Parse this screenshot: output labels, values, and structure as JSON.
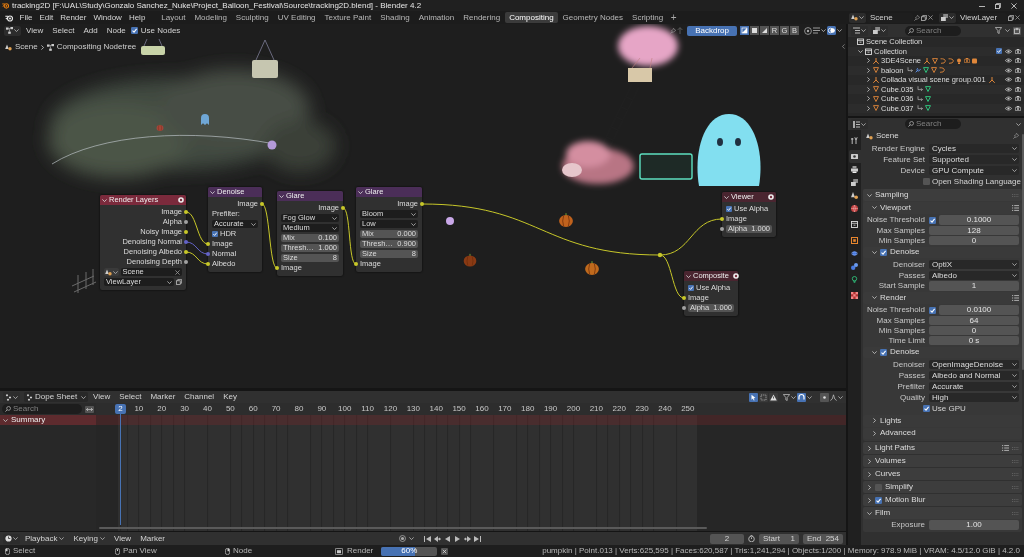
{
  "title_bar": {
    "title": "tracking2D [F:\\UAL\\Study\\Gonzalo Sanchez_Nuke\\Project_Balloon_Festival\\Source\\tracking2D.blend] - Blender 4.2"
  },
  "top_bar": {
    "menus": [
      "File",
      "Edit",
      "Render",
      "Window",
      "Help"
    ],
    "workspaces": [
      {
        "label": "Layout",
        "selected": false
      },
      {
        "label": "Modeling",
        "selected": false
      },
      {
        "label": "Sculpting",
        "selected": false
      },
      {
        "label": "UV Editing",
        "selected": false
      },
      {
        "label": "Texture Paint",
        "selected": false
      },
      {
        "label": "Shading",
        "selected": false
      },
      {
        "label": "Animation",
        "selected": false
      },
      {
        "label": "Rendering",
        "selected": false
      },
      {
        "label": "Compositing",
        "selected": true
      },
      {
        "label": "Geometry Nodes",
        "selected": false
      },
      {
        "label": "Scripting",
        "selected": false
      }
    ],
    "add_workspace": "+",
    "scene": "Scene",
    "view_layer": "ViewLayer"
  },
  "node_editor": {
    "menus": [
      "View",
      "Select",
      "Add",
      "Node"
    ],
    "use_nodes": {
      "label": "Use Nodes",
      "checked": true
    },
    "backdrop": {
      "label": "Backdrop",
      "on": true
    },
    "channels": [
      {
        "kind": "color_alpha",
        "selected": true
      },
      {
        "kind": "color",
        "selected": false
      },
      {
        "kind": "alpha",
        "selected": false
      },
      {
        "kind": "letter",
        "label": "R",
        "selected": false
      },
      {
        "kind": "letter",
        "label": "G",
        "selected": false
      },
      {
        "kind": "letter",
        "label": "B",
        "selected": false
      }
    ],
    "overlays": {
      "on": true
    },
    "breadcrumbs": [
      "Scene",
      "Compositing Nodetree"
    ],
    "nodes": [
      {
        "title": "Render Layers",
        "kind": "input",
        "color": "#7b2a3c",
        "rows": [
          {
            "kind": "output",
            "label": "Image",
            "color": "#c7c729"
          },
          {
            "kind": "output",
            "label": "Alpha",
            "color": "#a1a1a1"
          },
          {
            "kind": "output",
            "label": "Noisy Image",
            "color": "#c7c729"
          },
          {
            "kind": "output",
            "label": "Denoising Normal",
            "color": "#6363c7"
          },
          {
            "kind": "output",
            "label": "Denoising Albedo",
            "color": "#c7c729"
          },
          {
            "kind": "output",
            "label": "Denoising Depth",
            "color": "#a1a1a1"
          },
          {
            "kind": "scene",
            "value": "Scene"
          },
          {
            "kind": "layer",
            "value": "ViewLayer"
          }
        ]
      },
      {
        "title": "Denoise",
        "kind": "filter",
        "color": "#4b2e58",
        "rows": [
          {
            "kind": "output",
            "label": "Image",
            "color": "#c7c729"
          },
          {
            "kind": "label",
            "label": "Prefilter:"
          },
          {
            "kind": "dropdown",
            "value": "Accurate"
          },
          {
            "kind": "checkbox",
            "label": "HDR",
            "checked": true
          },
          {
            "kind": "input",
            "label": "Image",
            "color": "#c7c729"
          },
          {
            "kind": "input",
            "label": "Normal",
            "color": "#6363c7"
          },
          {
            "kind": "input",
            "label": "Albedo",
            "color": "#c7c729"
          }
        ]
      },
      {
        "title": "Glare",
        "kind": "filter",
        "color": "#4b2e58",
        "rows": [
          {
            "kind": "output",
            "label": "Image",
            "color": "#c7c729"
          },
          {
            "kind": "dropdown",
            "value": "Fog Glow"
          },
          {
            "kind": "dropdown",
            "value": "Medium"
          },
          {
            "kind": "field",
            "label": "Mix",
            "value": "0.100"
          },
          {
            "kind": "field",
            "label": "Thresh…",
            "value": "1.000"
          },
          {
            "kind": "field",
            "label": "Size",
            "value": "8"
          },
          {
            "kind": "input",
            "label": "Image",
            "color": "#c7c729"
          }
        ]
      },
      {
        "title": "Glare",
        "kind": "filter",
        "color": "#4b2e58",
        "rows": [
          {
            "kind": "output",
            "label": "Image",
            "color": "#c7c729"
          },
          {
            "kind": "dropdown",
            "value": "Bloom"
          },
          {
            "kind": "dropdown",
            "value": "Low"
          },
          {
            "kind": "field",
            "label": "Mix",
            "value": "0.000"
          },
          {
            "kind": "field",
            "label": "Thresh…",
            "value": "0.900"
          },
          {
            "kind": "field",
            "label": "Size",
            "value": "8"
          },
          {
            "kind": "input",
            "label": "Image",
            "color": "#c7c729"
          }
        ]
      },
      {
        "title": "Viewer",
        "kind": "output",
        "color": "#4a2530",
        "rows": [
          {
            "kind": "checkbox",
            "label": "Use Alpha",
            "checked": true
          },
          {
            "kind": "input",
            "label": "Image",
            "color": "#c7c729"
          },
          {
            "kind": "input_field",
            "label": "Alpha",
            "value": "1.000",
            "color": "#a1a1a1"
          }
        ]
      },
      {
        "title": "Composite",
        "kind": "output",
        "color": "#4a2530",
        "rows": [
          {
            "kind": "checkbox",
            "label": "Use Alpha",
            "checked": true
          },
          {
            "kind": "input",
            "label": "Image",
            "color": "#c7c729"
          },
          {
            "kind": "input_field",
            "label": "Alpha",
            "value": "1.000",
            "color": "#a1a1a1"
          }
        ]
      }
    ]
  },
  "dope_sheet": {
    "mode": "Dope Sheet",
    "menus": [
      "View",
      "Select",
      "Marker",
      "Channel",
      "Key"
    ],
    "toggles": [
      {
        "kind": "select_arrow",
        "on": true
      },
      {
        "kind": "box",
        "on": false
      },
      {
        "kind": "warning",
        "on": false
      }
    ],
    "snap": {
      "on": true
    },
    "search": {
      "placeholder": "Search"
    },
    "current_frame": "2",
    "frame_labels": [
      "10",
      "20",
      "30",
      "40",
      "50",
      "60",
      "70",
      "80",
      "90",
      "100",
      "110",
      "120",
      "130",
      "140",
      "150",
      "160",
      "170",
      "180",
      "190",
      "200",
      "210",
      "220",
      "230",
      "240",
      "250"
    ],
    "channels": [
      {
        "label": "Summary",
        "expanded": true
      }
    ]
  },
  "timeline": {
    "menus": [
      {
        "label": "Playback",
        "kind": "dropdown"
      },
      {
        "label": "Keying",
        "kind": "dropdown"
      },
      {
        "label": "View",
        "kind": "menu"
      },
      {
        "label": "Marker",
        "kind": "menu"
      }
    ],
    "current_frame": "2",
    "start": {
      "label": "Start",
      "value": "1"
    },
    "end": {
      "label": "End",
      "value": "254"
    }
  },
  "outliner": {
    "search": {
      "placeholder": "Search"
    },
    "tree": [
      {
        "label": "Scene Collection",
        "kind": "scene_collection",
        "children": [
          {
            "label": "Collection",
            "kind": "collection",
            "expanded": true,
            "checked": true,
            "visible": true,
            "children": [
              {
                "label": "3DE4Scene",
                "kind": "empty",
                "expanded": false,
                "visible": true
              },
              {
                "label": "baloon",
                "kind": "mesh",
                "expanded": false,
                "visible": true
              },
              {
                "label": "Collada visual scene group.001",
                "kind": "empty",
                "expanded": false,
                "visible": true
              },
              {
                "label": "Cube.035",
                "kind": "mesh",
                "expanded": false,
                "visible": true
              },
              {
                "label": "Cube.036",
                "kind": "mesh",
                "expanded": false,
                "visible": true
              },
              {
                "label": "Cube.037",
                "kind": "mesh",
                "expanded": false,
                "visible": true
              }
            ]
          }
        ]
      }
    ]
  },
  "properties": {
    "search": {
      "placeholder": "Search"
    },
    "tabs": [
      {
        "selected": false
      },
      {
        "selected": true
      },
      {
        "selected": false
      },
      {
        "selected": false
      },
      {
        "selected": false
      },
      {
        "selected": false
      },
      {
        "selected": false
      },
      {
        "selected": false
      },
      {
        "selected": false
      },
      {
        "selected": false
      },
      {
        "selected": false
      },
      {
        "selected": false
      }
    ],
    "context": "Scene",
    "rows": [
      {
        "kind": "dropdown",
        "label": "Render Engine",
        "value": "Cycles"
      },
      {
        "kind": "dropdown",
        "label": "Feature Set",
        "value": "Supported"
      },
      {
        "kind": "dropdown",
        "label": "Device",
        "value": "GPU Compute"
      },
      {
        "kind": "checkbox",
        "label": "Open Shading Language",
        "checked": false
      }
    ],
    "panels": [
      {
        "title": "Sampling",
        "expanded": true,
        "subpanels": [
          {
            "title": "Viewport",
            "expanded": true,
            "presets": true,
            "rows": [
              {
                "kind": "toggle_number",
                "label": "Noise Threshold",
                "checked": true,
                "value": "0.1000"
              },
              {
                "kind": "number",
                "label": "Max Samples",
                "value": "128"
              },
              {
                "kind": "number",
                "label": "Min Samples",
                "value": "0"
              }
            ]
          },
          {
            "title": "Denoise",
            "expanded": true,
            "checked": true,
            "rows": [
              {
                "kind": "dropdown",
                "label": "Denoiser",
                "value": "OptiX"
              },
              {
                "kind": "dropdown",
                "label": "Passes",
                "value": "Albedo"
              },
              {
                "kind": "number",
                "label": "Start Sample",
                "value": "1"
              }
            ]
          },
          {
            "title": "Render",
            "expanded": true,
            "presets": true,
            "rows": [
              {
                "kind": "toggle_number",
                "label": "Noise Threshold",
                "checked": true,
                "value": "0.0100"
              },
              {
                "kind": "number",
                "label": "Max Samples",
                "value": "64"
              },
              {
                "kind": "number",
                "label": "Min Samples",
                "value": "0"
              },
              {
                "kind": "number",
                "label": "Time Limit",
                "value": "0 s"
              }
            ]
          },
          {
            "title": "Denoise",
            "expanded": true,
            "checked": true,
            "rows": [
              {
                "kind": "dropdown",
                "label": "Denoiser",
                "value": "OpenImageDenoise"
              },
              {
                "kind": "dropdown",
                "label": "Passes",
                "value": "Albedo and Normal"
              },
              {
                "kind": "dropdown",
                "label": "Prefilter",
                "value": "Accurate"
              },
              {
                "kind": "dropdown",
                "label": "Quality",
                "value": "High"
              },
              {
                "kind": "checkbox",
                "label": "Use GPU",
                "checked": true
              }
            ]
          },
          {
            "title": "Lights",
            "expanded": false
          },
          {
            "title": "Advanced",
            "expanded": false
          }
        ]
      },
      {
        "title": "Light Paths",
        "expanded": false,
        "presets": true
      },
      {
        "title": "Volumes",
        "expanded": false
      },
      {
        "title": "Curves",
        "expanded": false
      },
      {
        "title": "Simplify",
        "expanded": false,
        "checked": false
      },
      {
        "title": "Motion Blur",
        "expanded": false,
        "checked": true
      },
      {
        "title": "Film",
        "expanded": true,
        "rows": [
          {
            "kind": "number",
            "label": "Exposure",
            "value": "1.00"
          }
        ]
      }
    ]
  },
  "status_bar": {
    "hints": [
      {
        "kind": "left_mouse",
        "label": "Select"
      },
      {
        "kind": "middle_mouse",
        "label": "Pan View"
      },
      {
        "kind": "right_mouse",
        "label": "Node"
      }
    ],
    "job": {
      "label": "Render",
      "level": 0.6,
      "reading": "60%"
    },
    "stats": "pumpkin | Point.013 | Verts:625,595 | Faces:620,587 | Tris:1,241,294 | Objects:1/200 | Memory: 978.9 MiB | VRAM: 4.5/12.0 GiB | 4.2.0"
  }
}
